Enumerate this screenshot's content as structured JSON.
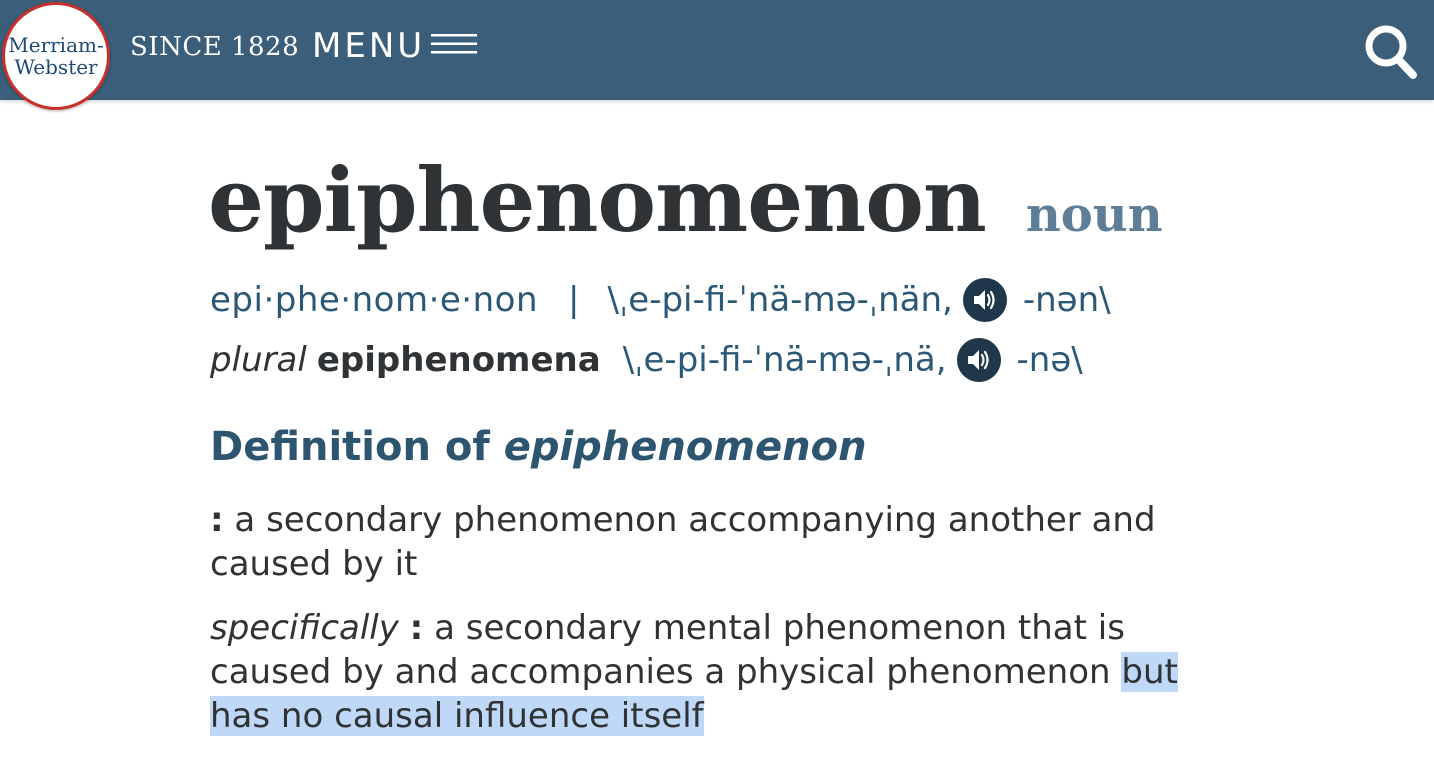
{
  "header": {
    "logo_line1": "Merriam-",
    "logo_line2": "Webster",
    "since": "SINCE 1828",
    "menu_label": "MENU",
    "menu_icon": "hamburger-icon",
    "search_icon": "search-icon"
  },
  "entry": {
    "headword": "epiphenomenon",
    "part_of_speech": "noun",
    "syllables": "epi·phe·nom·e·non",
    "separator": "|",
    "pron_main": "\\ˌe-pi-fi-ˈnä-mə-ˌnän,",
    "pron_alt": "-nən\\",
    "plural_label": "plural",
    "plural_word": "epiphenomena",
    "plural_pron_main": "\\ˌe-pi-fi-ˈnä-mə-ˌnä,",
    "plural_pron_alt": "-nə\\",
    "audio_icon": "speaker-icon"
  },
  "definition": {
    "heading_prefix": "Definition of",
    "heading_word": "epiphenomenon",
    "colon": ":",
    "sense1": "a secondary phenomenon accompanying another and caused by it",
    "sense2_label": "specifically",
    "sense2_text": "a secondary mental phenomenon that is caused by and accompanies a physical phenomenon",
    "sense2_highlighted": "but has no causal influence itself"
  },
  "colors": {
    "header_bg": "#3b5e7a",
    "logo_ring": "#c9302c",
    "link_blue": "#2b5876",
    "heading_blue": "#2d5570",
    "pos_color": "#5d7e96",
    "audio_bg": "#20374b",
    "highlight": "#c0d8f7"
  }
}
